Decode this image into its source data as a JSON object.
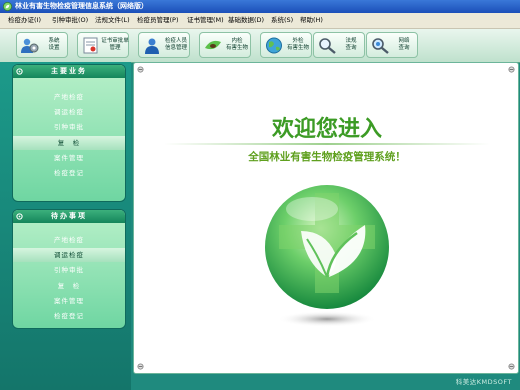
{
  "window": {
    "title": "林业有害生物检疫管理信息系统（网络版）"
  },
  "menu": [
    "检疫办证(I)",
    "引种审批(O)",
    "法规文件(L)",
    "检疫员管理(P)",
    "证书管理(M)",
    "基础数据(D)",
    "系统(S)",
    "帮助(H)"
  ],
  "toolbar": [
    {
      "label": "系统\n设置",
      "icon": "settings-people-icon"
    },
    {
      "label": "证书审批单\n管理",
      "icon": "certificate-icon"
    },
    {
      "label": "检疫人员\n信息管理",
      "icon": "staff-icon"
    },
    {
      "label": "内检\n有害生物",
      "icon": "pest-icon"
    },
    {
      "label": "外检\n有害生物",
      "icon": "globe-icon"
    },
    {
      "label": "法规\n查询",
      "icon": "search-icon"
    },
    {
      "label": "网络\n查询",
      "icon": "network-search-icon"
    }
  ],
  "main_business": {
    "title": "主要业务",
    "items": [
      "产地检疫",
      "调运检疫",
      "引种审批",
      "复　检",
      "案件管理",
      "检疫登记"
    ],
    "active_index": 3
  },
  "pending": {
    "title": "待办事项",
    "items": [
      "产地检疫",
      "调运检疫",
      "引种审批",
      "复　检",
      "案件管理",
      "检疫登记"
    ],
    "active_index": 1
  },
  "welcome": {
    "heading": "欢迎您进入",
    "subtitle": "全国林业有害生物检疫管理系统！"
  },
  "footer": {
    "copyright": "科美达KMDSOFT"
  },
  "colors": {
    "accent_green": "#3c9b25",
    "panel_teal": "#1c9a8a",
    "title_blue": "#1b4fb8"
  }
}
